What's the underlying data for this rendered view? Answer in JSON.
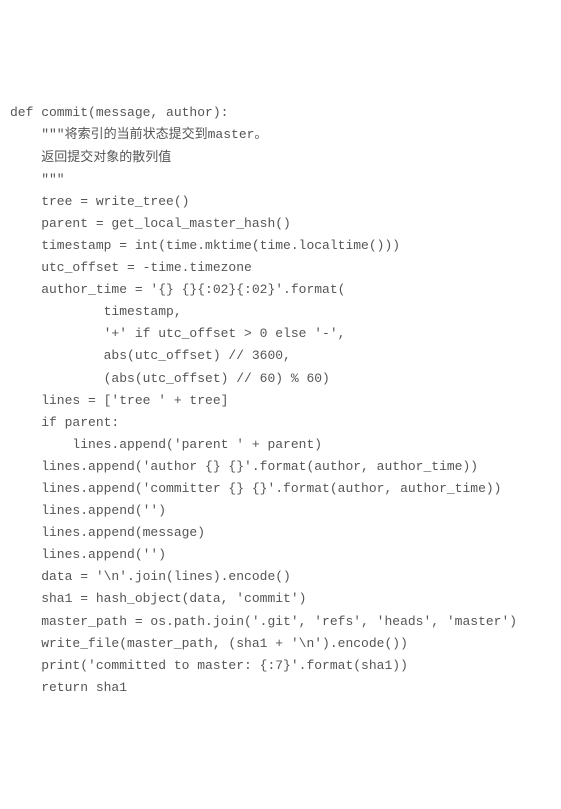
{
  "code": {
    "lines": [
      "def commit(message, author):",
      "    \"\"\"将索引的当前状态提交到master。",
      "    返回提交对象的散列值",
      "    \"\"\"",
      "    tree = write_tree()",
      "    parent = get_local_master_hash()",
      "    timestamp = int(time.mktime(time.localtime()))",
      "    utc_offset = -time.timezone",
      "    author_time = '{} {}{:02}{:02}'.format(",
      "            timestamp,",
      "            '+' if utc_offset > 0 else '-',",
      "            abs(utc_offset) // 3600,",
      "            (abs(utc_offset) // 60) % 60)",
      "    lines = ['tree ' + tree]",
      "    if parent:",
      "        lines.append('parent ' + parent)",
      "    lines.append('author {} {}'.format(author, author_time))",
      "    lines.append('committer {} {}'.format(author, author_time))",
      "    lines.append('')",
      "    lines.append(message)",
      "    lines.append('')",
      "    data = '\\n'.join(lines).encode()",
      "    sha1 = hash_object(data, 'commit')",
      "    master_path = os.path.join('.git', 'refs', 'heads', 'master')",
      "    write_file(master_path, (sha1 + '\\n').encode())",
      "    print('committed to master: {:7}'.format(sha1))",
      "    return sha1"
    ]
  }
}
